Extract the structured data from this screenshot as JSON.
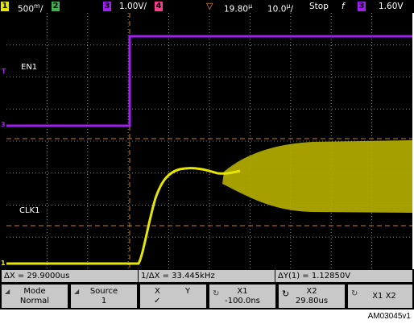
{
  "status": {
    "ch1_num": "1",
    "ch1_scale": "500",
    "ch1_unit_suffix": "/",
    "ch2_num": "2",
    "ch3_num": "3",
    "ch3_scale": "1.00V/",
    "ch4_num": "4",
    "time_position": "19.80",
    "time_scale": "10.0",
    "time_unit_suffix": "/",
    "run_state": "Stop",
    "trigger_slope": "f",
    "trigger_source": "3",
    "trigger_level": "1.60V"
  },
  "labels": {
    "en1": "EN1",
    "clk1": "CLK1",
    "marker_t": "T",
    "marker_3": "3",
    "marker_1": "1"
  },
  "measurements": {
    "delta_x": "ΔX = 29.9000us",
    "inv_delta_x": "1/ΔX = 33.445kHz",
    "delta_y": "ΔY(1) = 1.12850V"
  },
  "softkeys": [
    {
      "line1": "Mode",
      "line2": "Normal"
    },
    {
      "line1": "Source",
      "line2": "1"
    },
    {
      "line1": "X",
      "line2": "✓",
      "line3": "Y"
    },
    {
      "line1": "X1",
      "line2": "-100.0ns"
    },
    {
      "line1": "X2",
      "line2": "29.80us"
    },
    {
      "line1": "X1 X2",
      "line2": ""
    }
  ],
  "footer": "AM03045v1",
  "colors": {
    "ch1": "#e6e600",
    "ch3": "#a020f0",
    "cursor": "#c87d2a",
    "grid": "#808080"
  }
}
